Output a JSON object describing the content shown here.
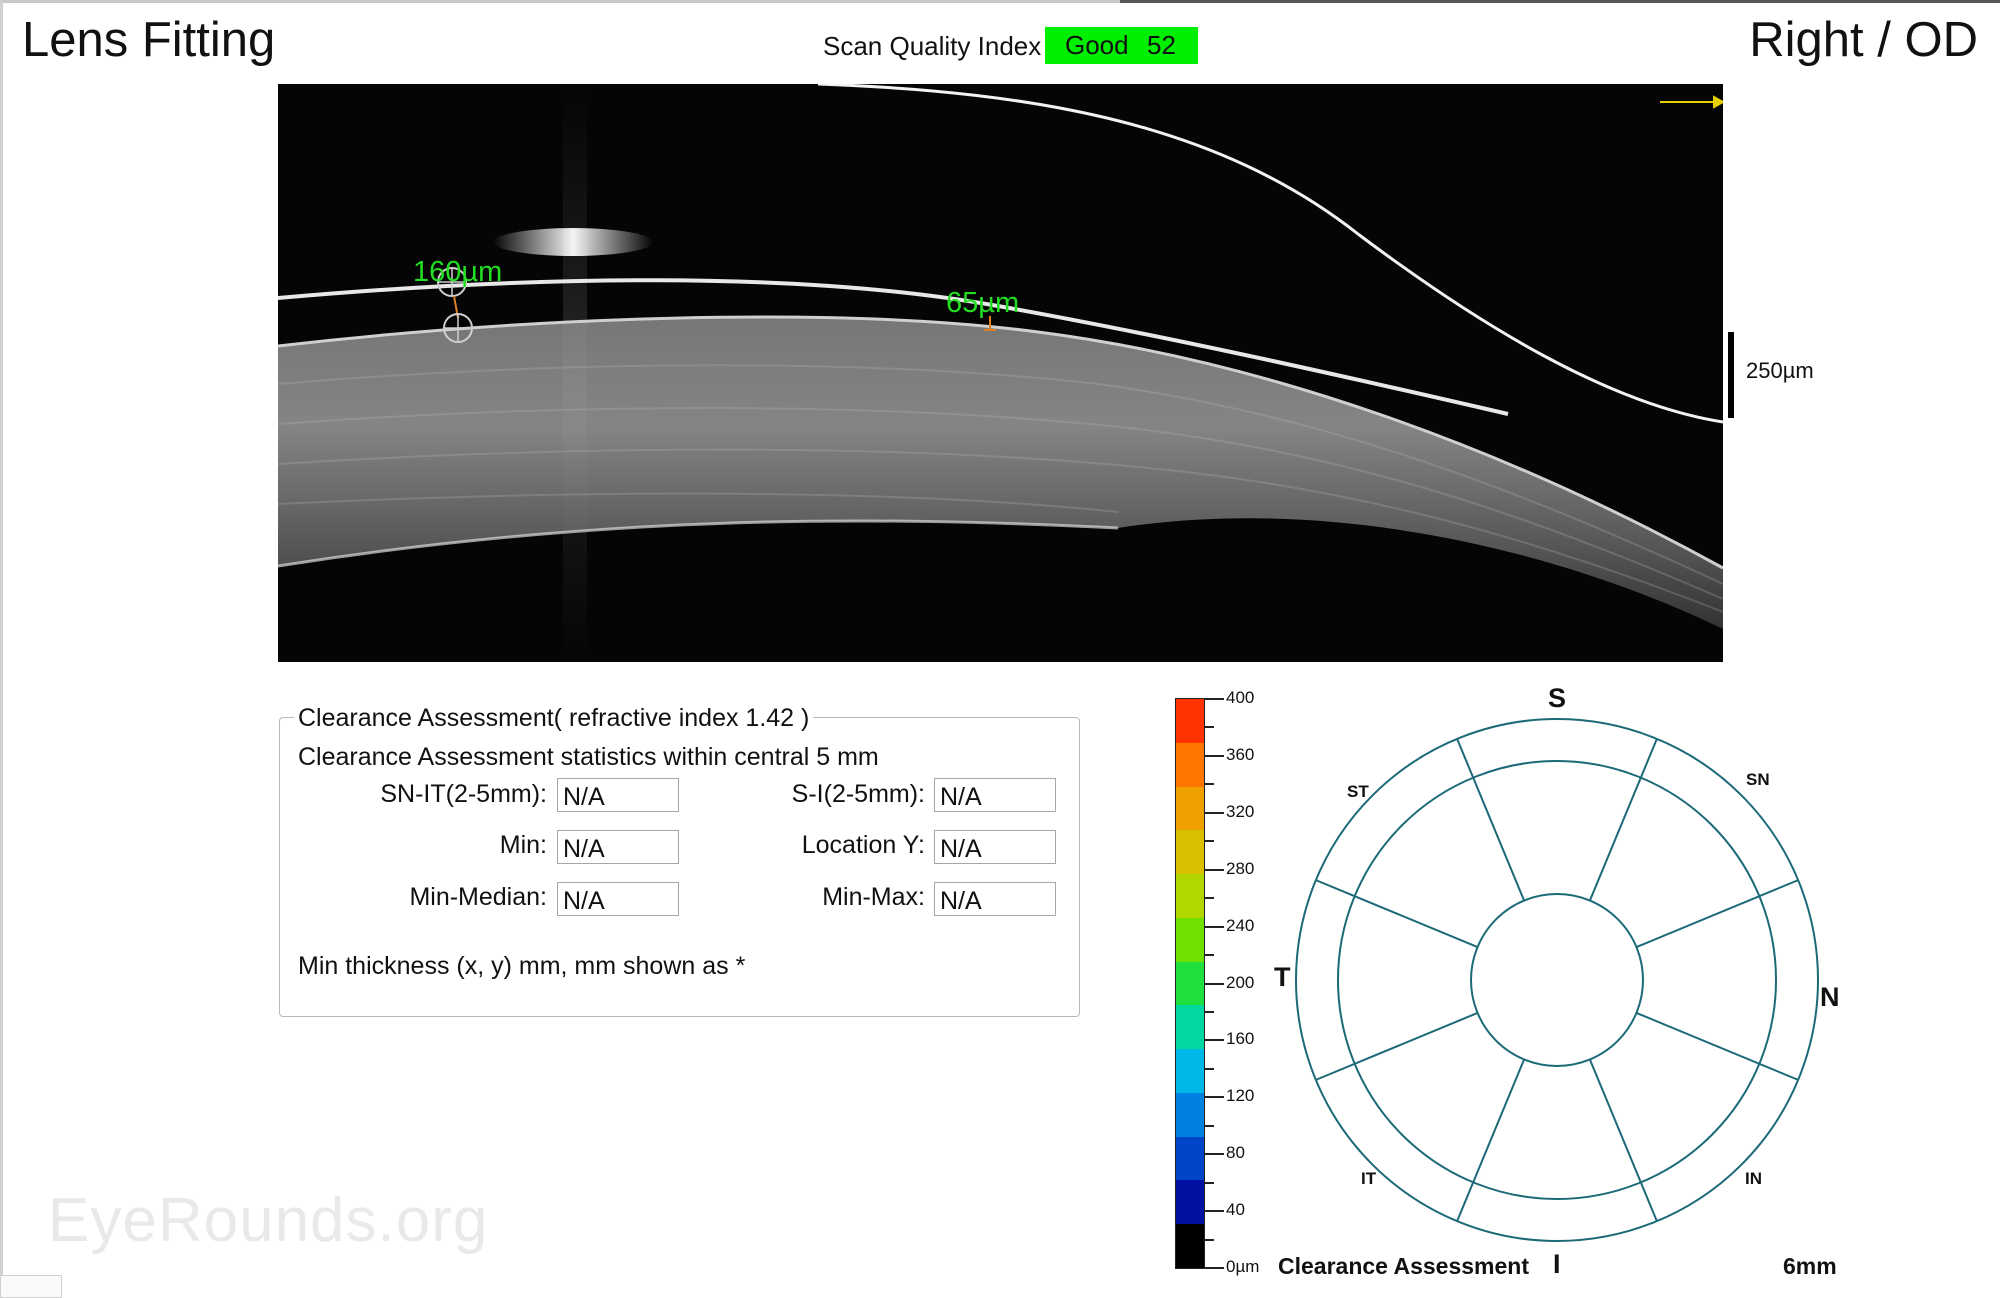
{
  "header": {
    "title": "Lens Fitting",
    "eye": "Right / OD",
    "scan_quality": {
      "label": "Scan Quality Index",
      "quality": "Good",
      "value": "52",
      "color": "#00ee00"
    }
  },
  "scan_image": {
    "measurements": [
      {
        "label": "160µm",
        "color": "#22dd22"
      },
      {
        "label": "65µm",
        "color": "#22dd22"
      }
    ],
    "scale_bar_label": "250µm",
    "arrow_color": "#e6d000"
  },
  "clearance": {
    "legend": "Clearance Assessment( refractive index  1.42 )",
    "subtitle": "Clearance Assessment statistics within central 5 mm",
    "fields": {
      "sn_it": {
        "label": "SN-IT(2-5mm):",
        "value": "N/A"
      },
      "s_i": {
        "label": "S-I(2-5mm):",
        "value": "N/A"
      },
      "min": {
        "label": "Min:",
        "value": "N/A"
      },
      "location_y": {
        "label": "Location Y:",
        "value": "N/A"
      },
      "min_median": {
        "label": "Min-Median:",
        "value": "N/A"
      },
      "min_max": {
        "label": "Min-Max:",
        "value": "N/A"
      }
    },
    "note": "Min thickness (x, y) mm, mm shown as *"
  },
  "color_scale": {
    "ticks": [
      "400",
      "360",
      "320",
      "280",
      "240",
      "200",
      "160",
      "120",
      "80",
      "40",
      "0µm"
    ],
    "colors": [
      "#ff3300",
      "#ff7700",
      "#f0a000",
      "#d8c000",
      "#b0d800",
      "#70e000",
      "#20e040",
      "#00d8a0",
      "#00b8e8",
      "#0080e0",
      "#0044c8",
      "#0010a0",
      "#000000"
    ]
  },
  "sector_map": {
    "labels": {
      "S": "S",
      "I": "I",
      "T": "T",
      "N": "N",
      "ST": "ST",
      "SN": "SN",
      "IT": "IT",
      "IN": "IN"
    },
    "title": "Clearance Assessment",
    "diameter": "6mm",
    "line_color": "#1c6a78"
  },
  "watermark": "EyeRounds.org"
}
